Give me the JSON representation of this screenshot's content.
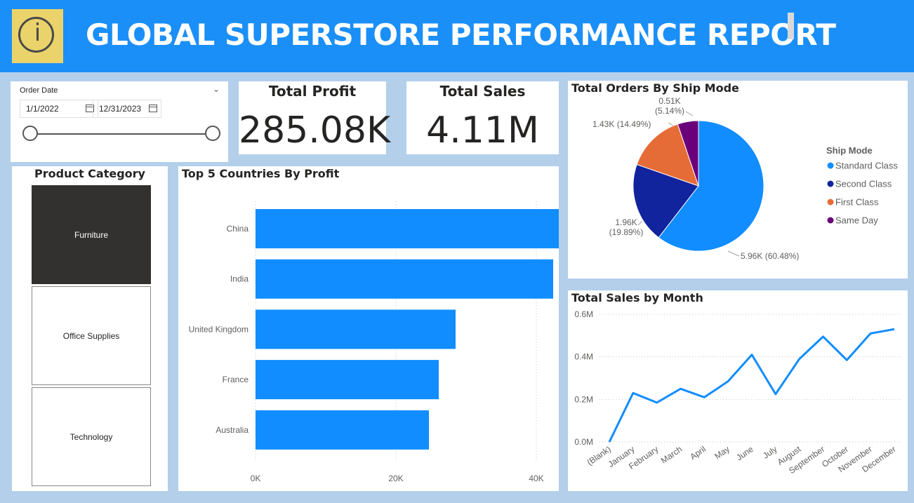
{
  "header": {
    "title": "GLOBAL SUPERSTORE PERFORMANCE REPORT",
    "logo_icon": "info-icon",
    "colors": {
      "header_bg": "#1b8ff8",
      "logo_bg": "#ead36a"
    }
  },
  "date_slicer": {
    "title": "Order Date",
    "start": "1/1/2022",
    "end": "12/31/2023"
  },
  "kpis": {
    "profit_title": "Total Profit",
    "profit_value": "285.08K",
    "sales_title": "Total Sales",
    "sales_value": "4.11M"
  },
  "category_slicer": {
    "title": "Product Category",
    "items": [
      "Furniture",
      "Office Supplies",
      "Technology"
    ],
    "selected": "Furniture"
  },
  "chart_data": [
    {
      "type": "bar",
      "orientation": "horizontal",
      "title": "Top 5 Countries By Profit",
      "categories": [
        "China",
        "India",
        "United Kingdom",
        "France",
        "Australia"
      ],
      "values": [
        46100,
        42400,
        28500,
        26100,
        24700
      ],
      "xlim": [
        0,
        48000
      ],
      "xticks": [
        0,
        20000,
        40000
      ],
      "tick_labels": [
        "0K",
        "20K",
        "40K"
      ],
      "color": "#118dff",
      "grid": true
    },
    {
      "type": "pie",
      "title": "Total Orders By Ship Mode",
      "legend_title": "Ship Mode",
      "legend_position": "right",
      "slices": [
        {
          "name": "Standard Class",
          "value": 5.96,
          "label": "5.96K (60.48%)",
          "color": "#118dff"
        },
        {
          "name": "Second Class",
          "value": 1.96,
          "label": "1.96K (19.89%)",
          "color": "#12239e"
        },
        {
          "name": "First Class",
          "value": 1.43,
          "label": "1.43K (14.49%)",
          "color": "#e66c37"
        },
        {
          "name": "Same Day",
          "value": 0.51,
          "label": "0.51K (5.14%)",
          "color": "#6b007b"
        }
      ]
    },
    {
      "type": "line",
      "title": "Total Sales by Month",
      "categories": [
        "(Blank)",
        "January",
        "February",
        "March",
        "April",
        "May",
        "June",
        "July",
        "August",
        "September",
        "October",
        "November",
        "December"
      ],
      "values": [
        0,
        0.23,
        0.185,
        0.25,
        0.21,
        0.285,
        0.41,
        0.225,
        0.39,
        0.495,
        0.385,
        0.51,
        0.53
      ],
      "ylim": [
        0,
        0.6
      ],
      "yticks": [
        0,
        0.2,
        0.4,
        0.6
      ],
      "ytick_labels": [
        "0.0M",
        "0.2M",
        "0.4M",
        "0.6M"
      ],
      "color": "#118dff",
      "grid": true
    }
  ]
}
